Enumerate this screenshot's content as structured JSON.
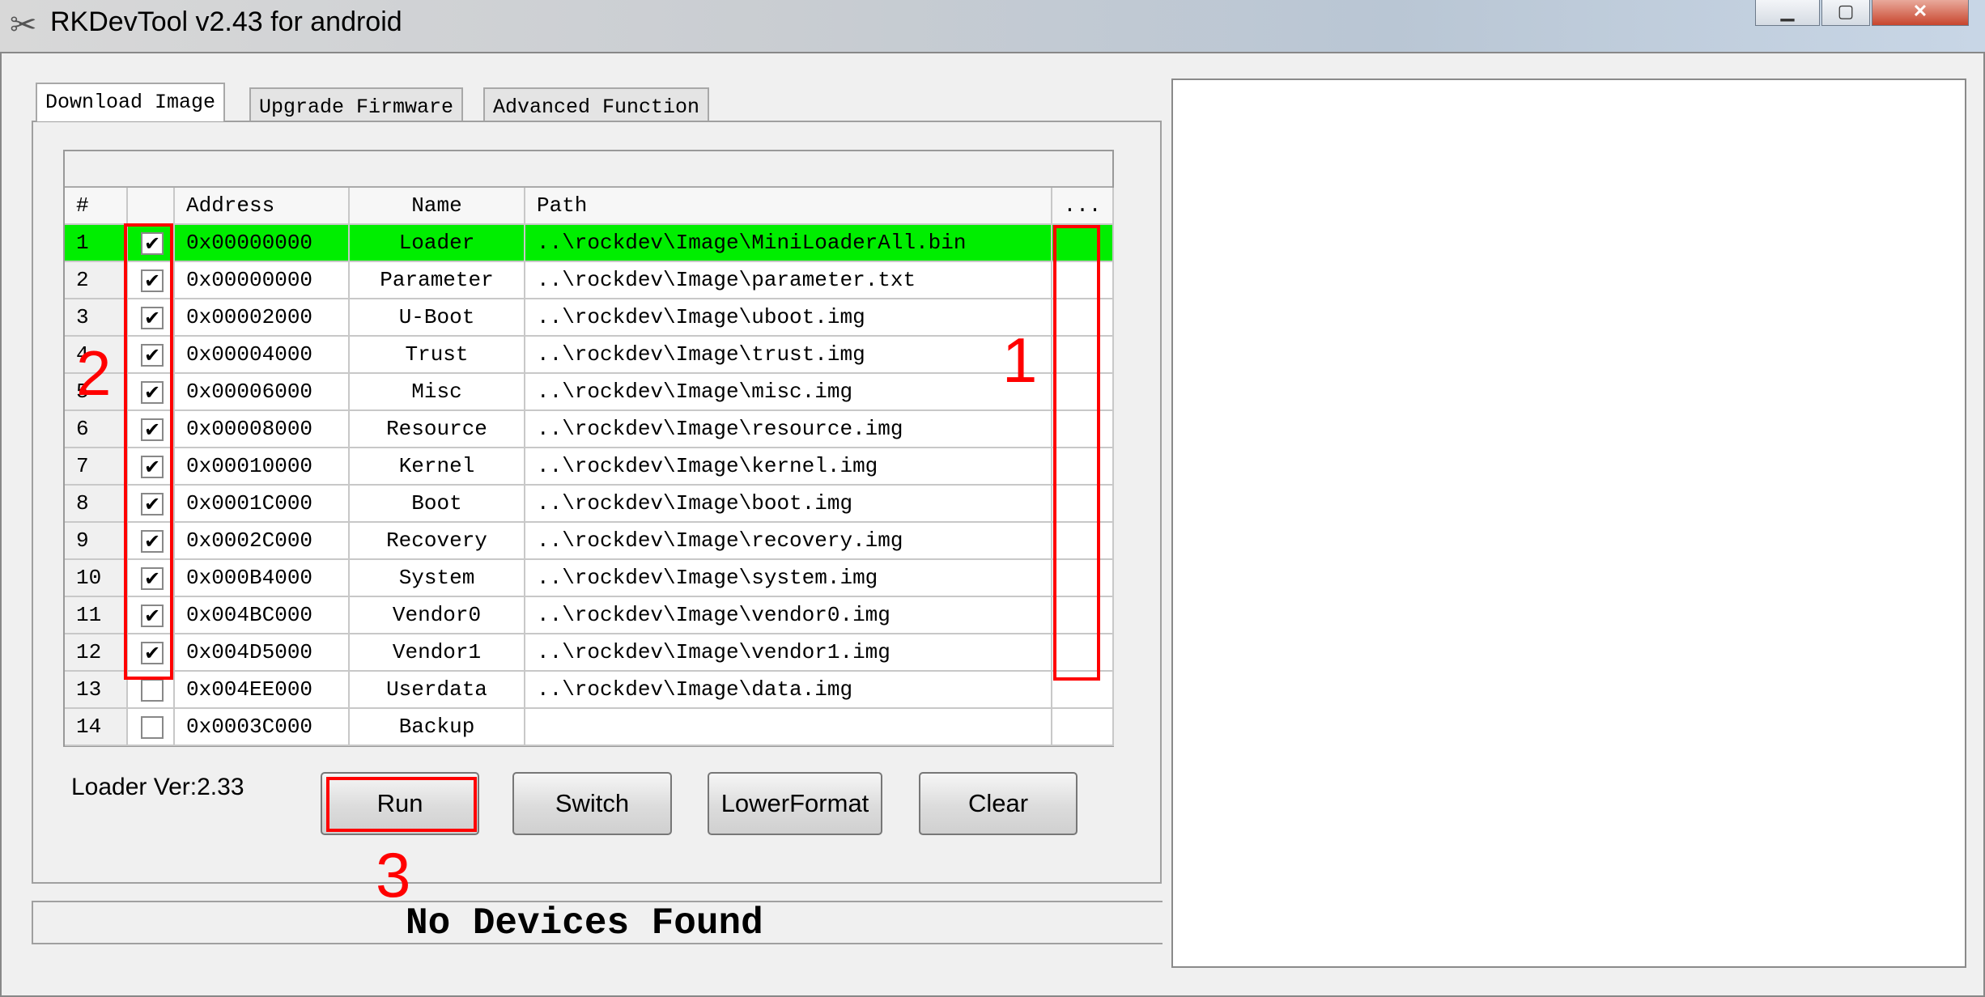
{
  "window": {
    "title": "RKDevTool v2.43 for android",
    "icon": "tools-icon"
  },
  "tabs": [
    {
      "label": "Download Image",
      "active": true
    },
    {
      "label": "Upgrade Firmware"
    },
    {
      "label": "Advanced Function"
    }
  ],
  "table": {
    "headers": [
      "#",
      "",
      "Address",
      "Name",
      "Path",
      "..."
    ],
    "rows": [
      {
        "n": "1",
        "checked": true,
        "address": "0x00000000",
        "name": "Loader",
        "path": "..\\rockdev\\Image\\MiniLoaderAll.bin",
        "highlight": "#00ee00"
      },
      {
        "n": "2",
        "checked": true,
        "address": "0x00000000",
        "name": "Parameter",
        "path": "..\\rockdev\\Image\\parameter.txt"
      },
      {
        "n": "3",
        "checked": true,
        "address": "0x00002000",
        "name": "U-Boot",
        "path": "..\\rockdev\\Image\\uboot.img"
      },
      {
        "n": "4",
        "checked": true,
        "address": "0x00004000",
        "name": "Trust",
        "path": "..\\rockdev\\Image\\trust.img"
      },
      {
        "n": "5",
        "checked": true,
        "address": "0x00006000",
        "name": "Misc",
        "path": "..\\rockdev\\Image\\misc.img"
      },
      {
        "n": "6",
        "checked": true,
        "address": "0x00008000",
        "name": "Resource",
        "path": "..\\rockdev\\Image\\resource.img"
      },
      {
        "n": "7",
        "checked": true,
        "address": "0x00010000",
        "name": "Kernel",
        "path": "..\\rockdev\\Image\\kernel.img"
      },
      {
        "n": "8",
        "checked": true,
        "address": "0x0001C000",
        "name": "Boot",
        "path": "..\\rockdev\\Image\\boot.img"
      },
      {
        "n": "9",
        "checked": true,
        "address": "0x0002C000",
        "name": "Recovery",
        "path": "..\\rockdev\\Image\\recovery.img"
      },
      {
        "n": "10",
        "checked": true,
        "address": "0x000B4000",
        "name": "System",
        "path": "..\\rockdev\\Image\\system.img"
      },
      {
        "n": "11",
        "checked": true,
        "address": "0x004BC000",
        "name": "Vendor0",
        "path": "..\\rockdev\\Image\\vendor0.img"
      },
      {
        "n": "12",
        "checked": true,
        "address": "0x004D5000",
        "name": "Vendor1",
        "path": "..\\rockdev\\Image\\vendor1.img"
      },
      {
        "n": "13",
        "checked": false,
        "address": "0x004EE000",
        "name": "Userdata",
        "path": "..\\rockdev\\Image\\data.img"
      },
      {
        "n": "14",
        "checked": false,
        "address": "0x0003C000",
        "name": "Backup",
        "path": ""
      }
    ]
  },
  "loader_ver": "Loader Ver:2.33",
  "buttons": {
    "run": "Run",
    "switch": "Switch",
    "lower_format": "LowerFormat",
    "clear": "Clear"
  },
  "status": "No Devices Found",
  "annotations": {
    "one": "1",
    "two": "2",
    "three": "3",
    "color": "#ff0000"
  }
}
